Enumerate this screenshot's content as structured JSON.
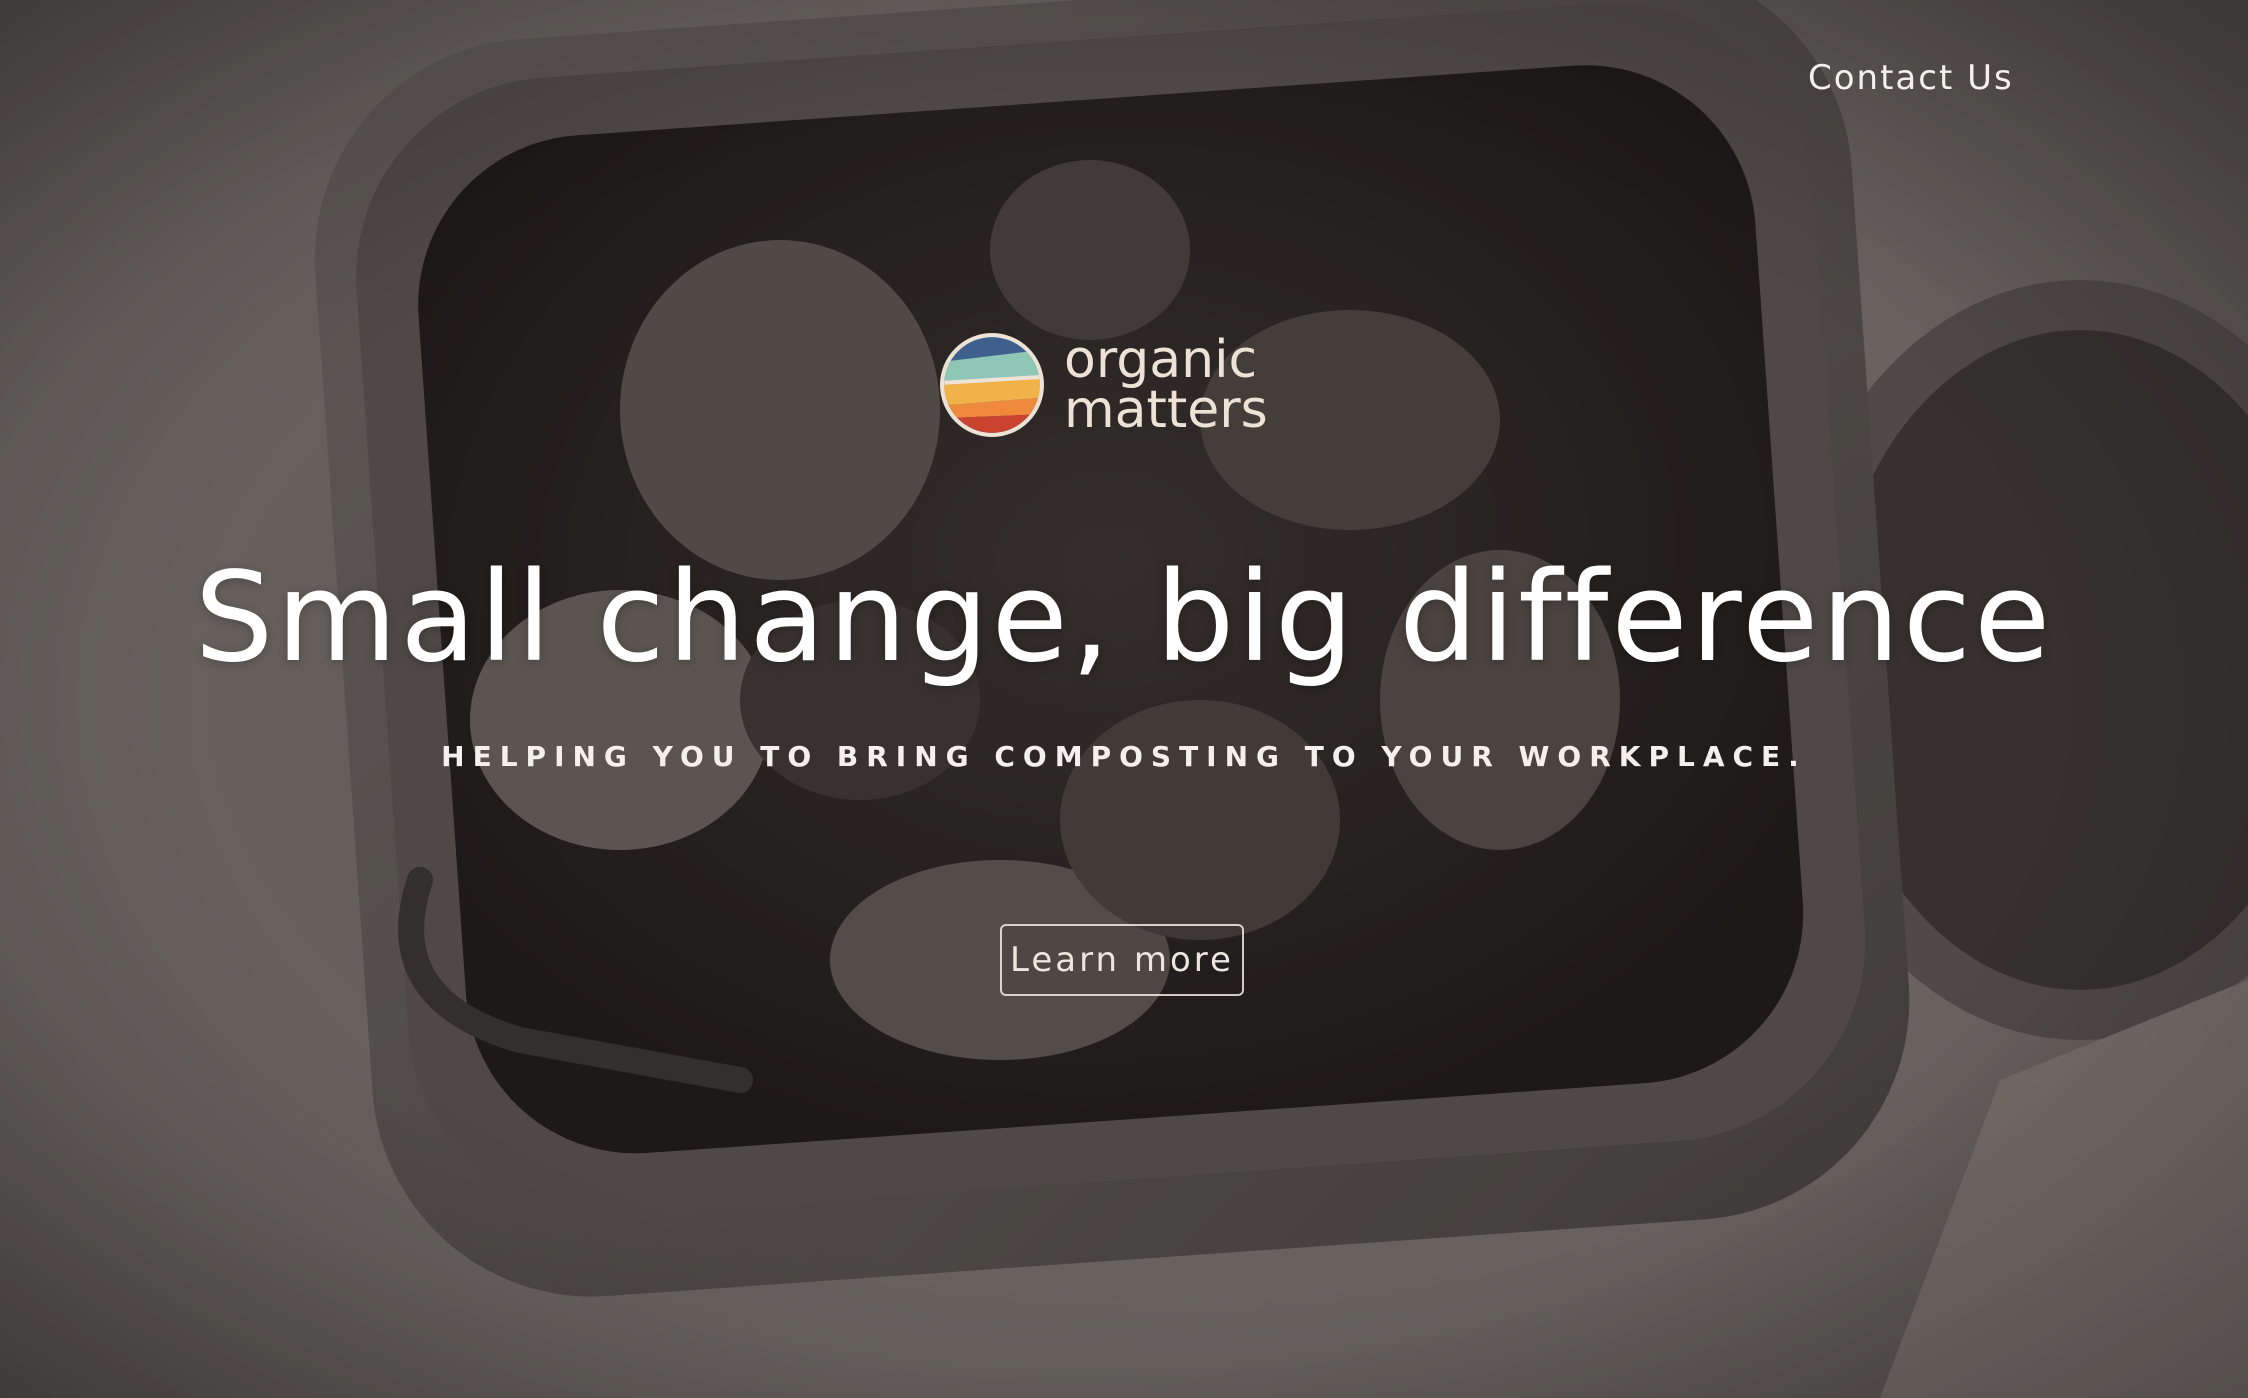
{
  "nav": {
    "contact_label": "Contact Us"
  },
  "brand": {
    "line1": "organic",
    "line2": "matters",
    "logo_stripe_colors": [
      "#3f5f8c",
      "#8fc7b7",
      "#f2b24a",
      "#ef8a3c",
      "#c9432f"
    ],
    "text_color": "#ece3d6"
  },
  "hero": {
    "headline": "Small change, big difference",
    "subheadline": "HELPING YOU TO BRING COMPOSTING TO YOUR WORKPLACE.",
    "cta_label": "Learn more",
    "background_image": "sepia photo of compost bin filled with food scraps"
  }
}
